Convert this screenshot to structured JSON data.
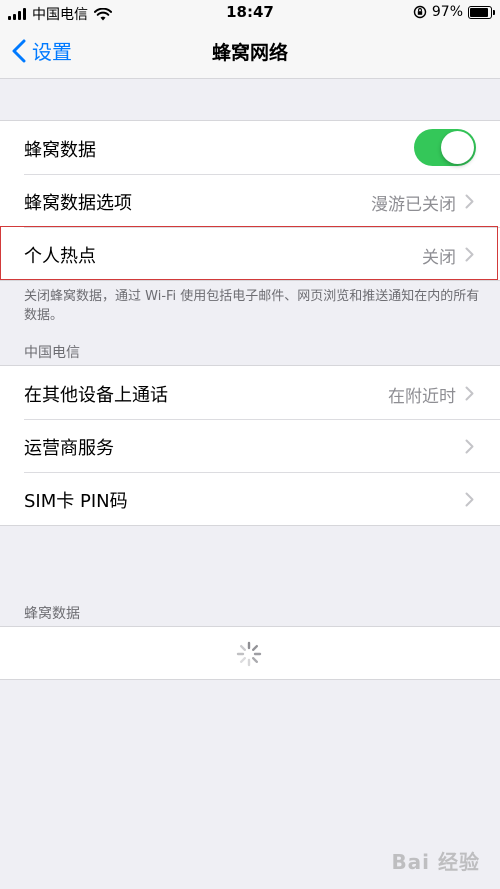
{
  "status_bar": {
    "carrier": "中国电信",
    "time": "18:47",
    "battery_percent": 97,
    "battery_label": "97%"
  },
  "nav": {
    "back_label": "设置",
    "title": "蜂窝网络"
  },
  "main_group": {
    "rows": [
      {
        "label": "蜂窝数据",
        "toggle_on": true
      },
      {
        "label": "蜂窝数据选项",
        "value": "漫游已关闭"
      },
      {
        "label": "个人热点",
        "value": "关闭"
      }
    ],
    "footnote": "关闭蜂窝数据，通过 Wi-Fi 使用包括电子邮件、网页浏览和推送通知在内的所有数据。"
  },
  "carrier_section": {
    "header": "中国电信",
    "rows": [
      {
        "label": "在其他设备上通话",
        "value": "在附近时"
      },
      {
        "label": "运营商服务",
        "value": ""
      },
      {
        "label": "SIM卡 PIN码",
        "value": ""
      }
    ]
  },
  "data_section": {
    "header": "蜂窝数据"
  },
  "watermark": "Bai 经验",
  "colors": {
    "accent": "#007aff",
    "toggle_on": "#34c759",
    "highlight_border": "#d23a3a",
    "background": "#efeff4"
  }
}
